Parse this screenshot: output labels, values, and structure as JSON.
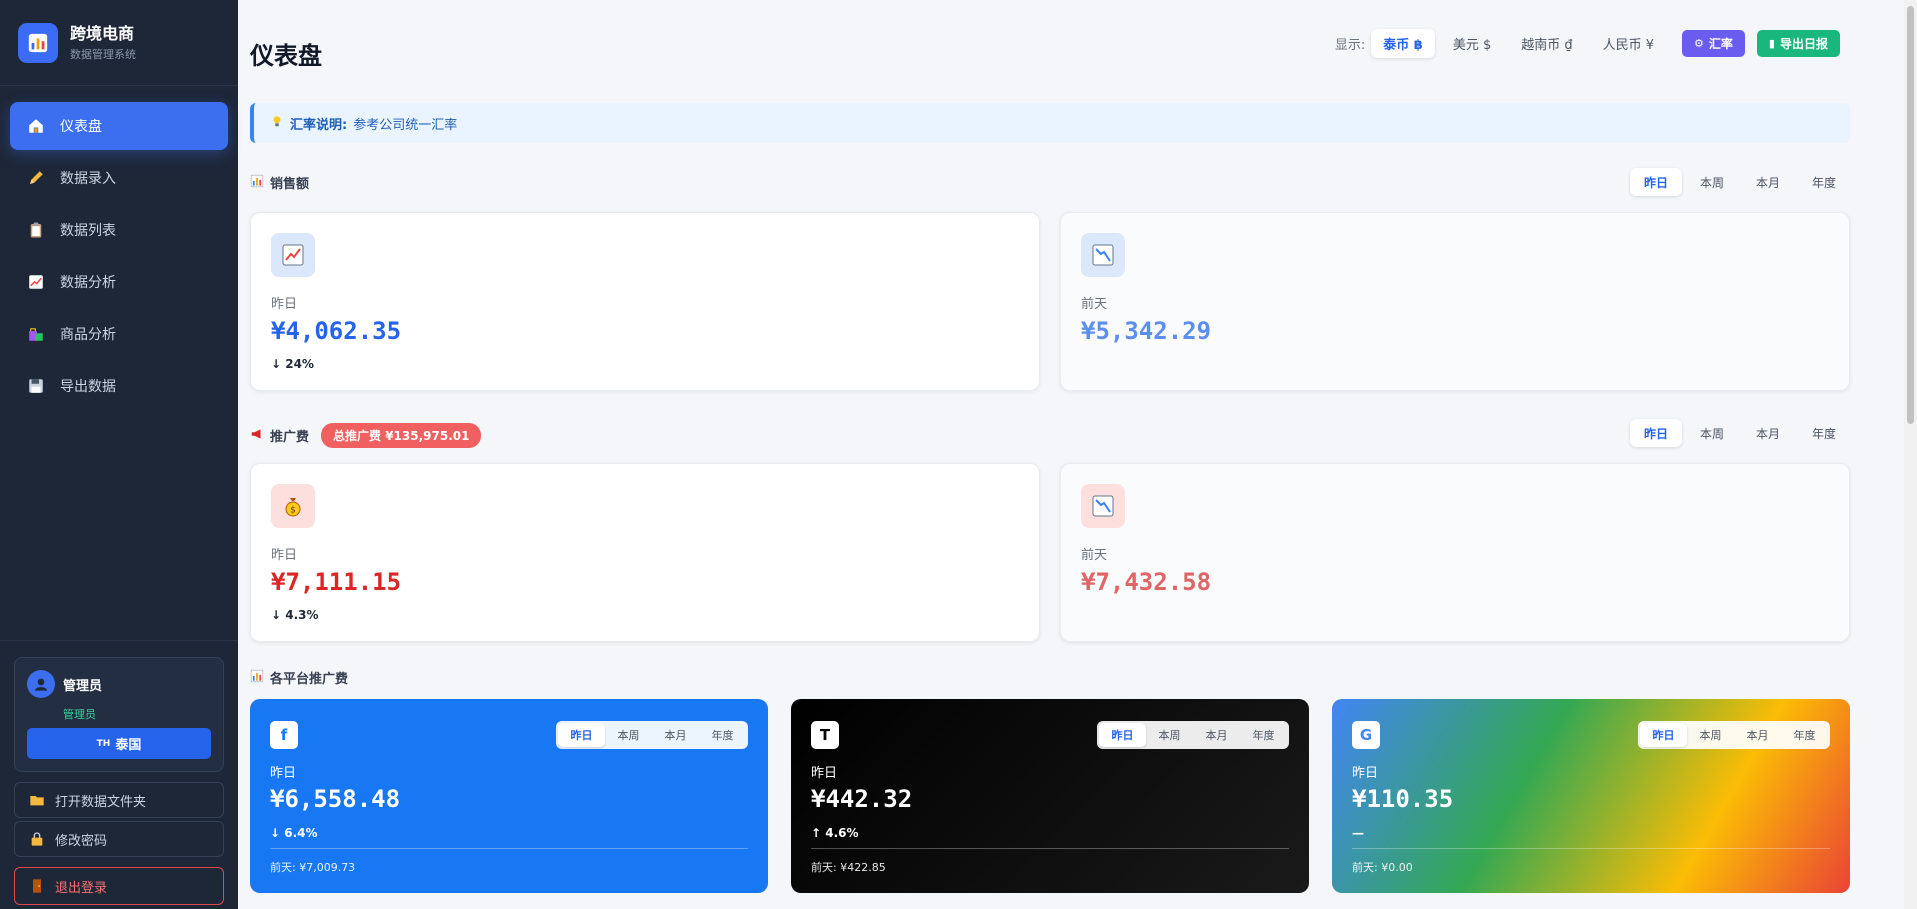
{
  "brand": {
    "title": "跨境电商",
    "subtitle": "数据管理系统"
  },
  "nav": [
    {
      "label": "仪表盘",
      "icon": "home-icon",
      "active": true
    },
    {
      "label": "数据录入",
      "icon": "pencil-icon"
    },
    {
      "label": "数据列表",
      "icon": "clipboard-icon"
    },
    {
      "label": "数据分析",
      "icon": "chart-up-icon"
    },
    {
      "label": "商品分析",
      "icon": "shopping-bags-icon"
    },
    {
      "label": "导出数据",
      "icon": "floppy-disk-icon"
    }
  ],
  "user": {
    "name": "管理员",
    "role": "管理员",
    "region_flag": "TH",
    "region": "泰国"
  },
  "sidebar_links": {
    "open_folder": "打开数据文件夹",
    "change_password": "修改密码",
    "logout": "退出登录"
  },
  "header": {
    "title": "仪表盘",
    "show_label": "显示:",
    "currencies": [
      "泰币 ฿",
      "美元 $",
      "越南币 ₫",
      "人民币 ¥"
    ],
    "active_currency": "泰币 ฿",
    "rate_button": "汇率",
    "export_button": "导出日报"
  },
  "notice": {
    "label": "汇率说明:",
    "text": "参考公司统一汇率"
  },
  "period_tabs": [
    "昨日",
    "本周",
    "本月",
    "年度"
  ],
  "sales": {
    "title": "销售额",
    "current": {
      "label": "昨日",
      "value": "¥4,062.35",
      "change": "↓ 24%"
    },
    "previous": {
      "label": "前天",
      "value": "¥5,342.29"
    }
  },
  "ads": {
    "title": "推广费",
    "total_badge": "总推广费 ¥135,975.01",
    "current": {
      "label": "昨日",
      "value": "¥7,111.15",
      "change": "↓ 4.3%"
    },
    "previous": {
      "label": "前天",
      "value": "¥7,432.58"
    }
  },
  "platforms": {
    "title": "各平台推广费",
    "items": [
      {
        "logo": "f",
        "label": "昨日",
        "value": "¥6,558.48",
        "change": "↓ 6.4%",
        "prev": "前天: ¥7,009.73",
        "color": "#1877f2"
      },
      {
        "logo": "T",
        "label": "昨日",
        "value": "¥442.32",
        "change": "↑ 4.6%",
        "prev": "前天: ¥422.85",
        "color": "#000000"
      },
      {
        "logo": "G",
        "label": "昨日",
        "value": "¥110.35",
        "change": "—",
        "prev": "前天: ¥0.00",
        "color": "#4285f4"
      }
    ]
  },
  "colors": {
    "sidebar": "#1e2738",
    "accent": "#3b6ff0",
    "sales_value": "#2563eb",
    "ads_value": "#dc2626"
  }
}
